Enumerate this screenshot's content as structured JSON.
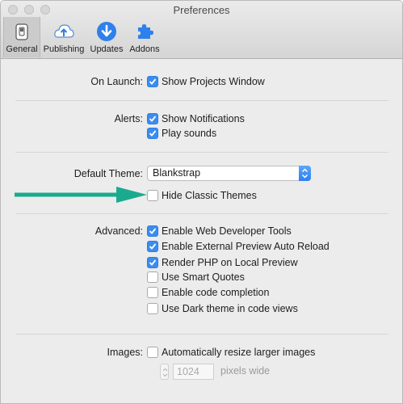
{
  "window": {
    "title": "Preferences"
  },
  "toolbar": {
    "items": [
      {
        "label": "General",
        "icon": "switch-icon"
      },
      {
        "label": "Publishing",
        "icon": "cloud-upload-icon"
      },
      {
        "label": "Updates",
        "icon": "download-arrow-icon"
      },
      {
        "label": "Addons",
        "icon": "puzzle-icon"
      }
    ],
    "selected": "General"
  },
  "on_launch": {
    "label": "On Launch:",
    "option": "Show Projects Window",
    "checked": true
  },
  "alerts": {
    "label": "Alerts:",
    "options": [
      {
        "text": "Show Notifications",
        "checked": true
      },
      {
        "text": "Play sounds",
        "checked": true
      }
    ]
  },
  "theme": {
    "label": "Default Theme:",
    "selected": "Blankstrap",
    "hide_classic": {
      "text": "Hide Classic Themes",
      "checked": false
    }
  },
  "advanced": {
    "label": "Advanced:",
    "options": [
      {
        "text": "Enable Web Developer Tools",
        "checked": true
      },
      {
        "text": "Enable External Preview Auto Reload",
        "checked": true
      },
      {
        "text": "Render PHP on Local Preview",
        "checked": true
      },
      {
        "text": "Use Smart Quotes",
        "checked": false
      },
      {
        "text": "Enable code completion",
        "checked": false
      },
      {
        "text": "Use Dark theme in code views",
        "checked": false
      }
    ]
  },
  "images": {
    "label": "Images:",
    "option": {
      "text": "Automatically resize larger images",
      "checked": false
    },
    "width_value": "1024",
    "width_unit": "pixels wide"
  },
  "colors": {
    "accent": "#3b8cf0",
    "annotation_arrow": "#1aab8e"
  }
}
